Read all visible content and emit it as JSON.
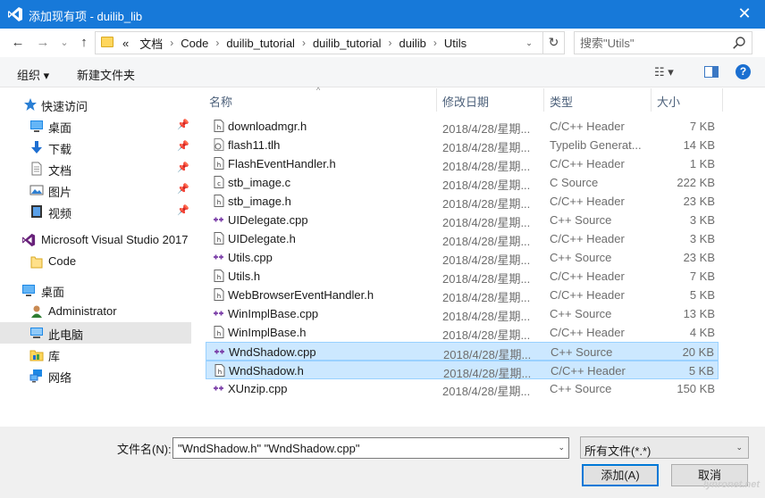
{
  "window": {
    "title": "添加现有项 - duilib_lib",
    "close": "✕"
  },
  "nav": {
    "back": "←",
    "forward": "→",
    "recent": "⌄",
    "up": "↑",
    "overflow": "«",
    "breadcrumbs": [
      "文档",
      "Code",
      "duilib_tutorial",
      "duilib_tutorial",
      "duilib",
      "Utils"
    ],
    "sep": "›",
    "dropdown": "⌄",
    "refresh": "↻",
    "search_placeholder": "搜索\"Utils\""
  },
  "toolbar": {
    "organize": "组织 ▾",
    "new_folder": "新建文件夹",
    "view": "☷ ▾",
    "help": "?"
  },
  "sidebar": {
    "items": [
      {
        "label": "快速访问",
        "icon": "star-icon"
      },
      {
        "label": "桌面",
        "icon": "desktop-icon",
        "pin": "📌"
      },
      {
        "label": "下载",
        "icon": "download-icon",
        "pin": "📌"
      },
      {
        "label": "文档",
        "icon": "document-icon",
        "pin": "📌"
      },
      {
        "label": "图片",
        "icon": "pictures-icon",
        "pin": "📌"
      },
      {
        "label": "视频",
        "icon": "video-icon",
        "pin": "📌"
      },
      {
        "label": "Microsoft Visual Studio 2017",
        "icon": "visual-studio-icon"
      },
      {
        "label": "Code",
        "icon": "folder-icon"
      },
      {
        "label": "桌面",
        "icon": "desktop-icon"
      },
      {
        "label": "Administrator",
        "icon": "user-icon"
      },
      {
        "label": "此电脑",
        "icon": "computer-icon"
      },
      {
        "label": "库",
        "icon": "library-icon"
      },
      {
        "label": "网络",
        "icon": "network-icon"
      }
    ]
  },
  "columns": {
    "name": "名称",
    "date": "修改日期",
    "type": "类型",
    "size": "大小",
    "sort": "^"
  },
  "files": [
    {
      "name": "downloadmgr.h",
      "date": "2018/4/28/星期...",
      "type": "C/C++ Header",
      "size": "7 KB",
      "kind": "header"
    },
    {
      "name": "flash11.tlh",
      "date": "2018/4/28/星期...",
      "type": "Typelib Generat...",
      "size": "14 KB",
      "kind": "tlh"
    },
    {
      "name": "FlashEventHandler.h",
      "date": "2018/4/28/星期...",
      "type": "C/C++ Header",
      "size": "1 KB",
      "kind": "header"
    },
    {
      "name": "stb_image.c",
      "date": "2018/4/28/星期...",
      "type": "C Source",
      "size": "222 KB",
      "kind": "c"
    },
    {
      "name": "stb_image.h",
      "date": "2018/4/28/星期...",
      "type": "C/C++ Header",
      "size": "23 KB",
      "kind": "header"
    },
    {
      "name": "UIDelegate.cpp",
      "date": "2018/4/28/星期...",
      "type": "C++ Source",
      "size": "3 KB",
      "kind": "cpp"
    },
    {
      "name": "UIDelegate.h",
      "date": "2018/4/28/星期...",
      "type": "C/C++ Header",
      "size": "3 KB",
      "kind": "header"
    },
    {
      "name": "Utils.cpp",
      "date": "2018/4/28/星期...",
      "type": "C++ Source",
      "size": "23 KB",
      "kind": "cpp"
    },
    {
      "name": "Utils.h",
      "date": "2018/4/28/星期...",
      "type": "C/C++ Header",
      "size": "7 KB",
      "kind": "header"
    },
    {
      "name": "WebBrowserEventHandler.h",
      "date": "2018/4/28/星期...",
      "type": "C/C++ Header",
      "size": "5 KB",
      "kind": "header"
    },
    {
      "name": "WinImplBase.cpp",
      "date": "2018/4/28/星期...",
      "type": "C++ Source",
      "size": "13 KB",
      "kind": "cpp"
    },
    {
      "name": "WinImplBase.h",
      "date": "2018/4/28/星期...",
      "type": "C/C++ Header",
      "size": "4 KB",
      "kind": "header"
    },
    {
      "name": "WndShadow.cpp",
      "date": "2018/4/28/星期...",
      "type": "C++ Source",
      "size": "20 KB",
      "kind": "cpp",
      "selected": true
    },
    {
      "name": "WndShadow.h",
      "date": "2018/4/28/星期...",
      "type": "C/C++ Header",
      "size": "5 KB",
      "kind": "header",
      "selected": true
    },
    {
      "name": "XUnzip.cpp",
      "date": "2018/4/28/星期...",
      "type": "C++ Source",
      "size": "150 KB",
      "kind": "cpp"
    }
  ],
  "footer": {
    "filename_label": "文件名(N):",
    "filename_value": "\"WndShadow.h\" \"WndShadow.cpp\"",
    "filter_value": "所有文件(*.*)",
    "add_button": "添加(A)",
    "cancel_button": "取消",
    "dropdown": "⌄",
    "watermark": "Iynronet.net"
  },
  "colors": {
    "titlebar": "#1779d9",
    "selection": "#cce8ff",
    "cpp_icon": "#7b3ea8"
  }
}
